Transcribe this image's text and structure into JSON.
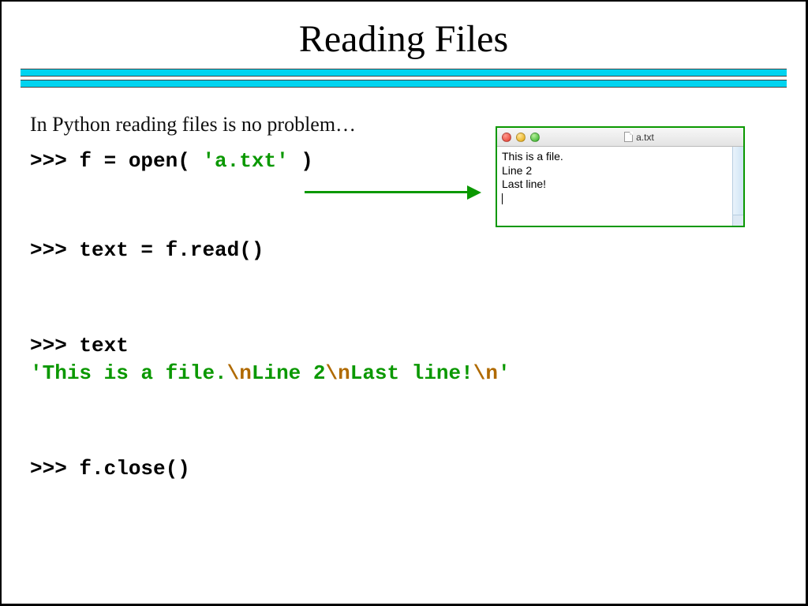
{
  "title": "Reading Files",
  "subtitle": "In Python reading files is no problem…",
  "code": {
    "l1_prompt": ">>> ",
    "l1_a": "f = open( ",
    "l1_str": "'a.txt'",
    "l1_b": " )",
    "l2_prompt": ">>> ",
    "l2": "text = f.read()",
    "l3_prompt": ">>> ",
    "l3": "text",
    "out_open": "'",
    "out_seg1": "This is a file.",
    "out_esc1": "\\n",
    "out_seg2": "Line 2",
    "out_esc2": "\\n",
    "out_seg3": "Last line!",
    "out_esc3": "\\n",
    "out_close": "'",
    "l4_prompt": ">>> ",
    "l4": "f.close()"
  },
  "file_window": {
    "filename": "a.txt",
    "line1": "This is a file.",
    "line2": "Line 2",
    "line3": "Last line!"
  }
}
